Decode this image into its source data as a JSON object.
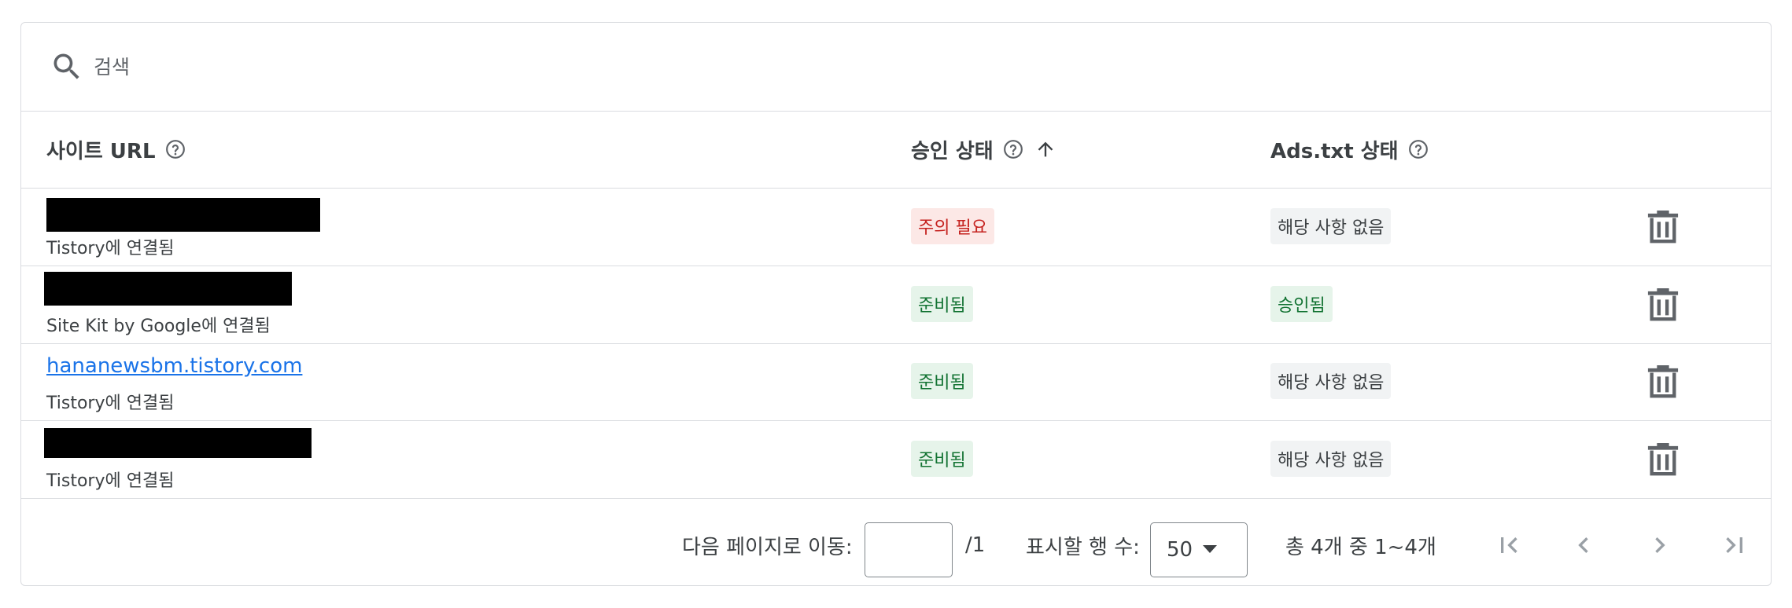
{
  "search": {
    "placeholder": "검색",
    "icon": "search-icon"
  },
  "table": {
    "headers": {
      "site_url": "사이트 URL",
      "approval_status": "승인 상태",
      "ads_txt_status": "Ads.txt 상태"
    },
    "rows": [
      {
        "url_redacted": true,
        "url": "",
        "connection": "Tistory에 연결됨",
        "approval": "주의 필요",
        "approval_type": "warn",
        "ads_txt": "해당 사항 없음",
        "ads_txt_type": "na"
      },
      {
        "url_redacted": true,
        "url": "",
        "connection": "Site Kit by Google에 연결됨",
        "approval": "준비됨",
        "approval_type": "ok",
        "ads_txt": "승인됨",
        "ads_txt_type": "ok"
      },
      {
        "url_redacted": false,
        "url": "hananewsbm.tistory.com",
        "connection": "Tistory에 연결됨",
        "approval": "준비됨",
        "approval_type": "ok",
        "ads_txt": "해당 사항 없음",
        "ads_txt_type": "na"
      },
      {
        "url_redacted": true,
        "url": "",
        "connection": "Tistory에 연결됨",
        "approval": "준비됨",
        "approval_type": "ok",
        "ads_txt": "해당 사항 없음",
        "ads_txt_type": "na"
      }
    ]
  },
  "footer": {
    "goto_label": "다음 페이지로 이동:",
    "goto_value": "",
    "total_pages": "/1",
    "rows_label": "표시할 행 수:",
    "rows_value": "50",
    "range_text": "총 4개 중 1~4개"
  },
  "colors": {
    "link": "#1a73e8",
    "warn_bg": "#fce8e6",
    "warn_text": "#c5221f",
    "ok_bg": "#e6f4ea",
    "ok_text": "#137333",
    "na_bg": "#f1f3f4",
    "border": "#dadce0"
  }
}
